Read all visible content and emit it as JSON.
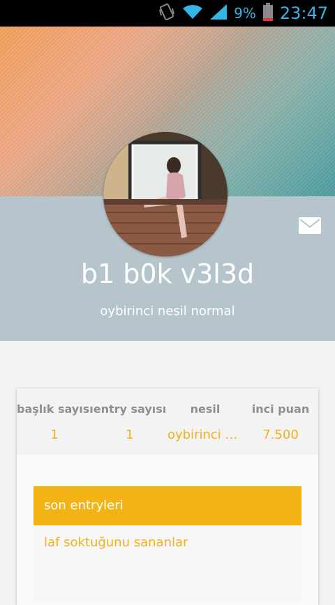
{
  "status_bar": {
    "battery_percent": "9%",
    "time": "23:47",
    "icons": [
      "vibrate-icon",
      "wifi-icon",
      "signal-icon",
      "battery-icon"
    ]
  },
  "profile": {
    "username": "b1 b0k v3l3d",
    "subtitle": "oybirinci nesil normal",
    "mail_icon": "mail-icon"
  },
  "stats": [
    {
      "label": "başlık sayısı",
      "value": "1"
    },
    {
      "label": "entry sayısı",
      "value": "1"
    },
    {
      "label": "nesil",
      "value": "oybirinci nesil normal"
    },
    {
      "label": "inci puan",
      "value": "7.500"
    }
  ],
  "tabs": {
    "active": "son entryleri",
    "inactive": "laf soktuğunu sananlar"
  },
  "colors": {
    "accent": "#f4b315",
    "panel": "#b6c4cb",
    "status_text": "#33b5e5"
  }
}
